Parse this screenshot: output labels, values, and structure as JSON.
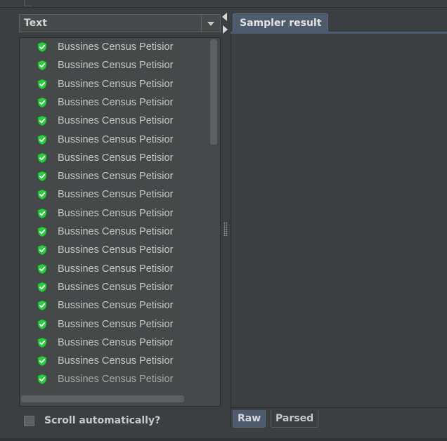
{
  "results_tree": {
    "renderer_select": {
      "value": "Text"
    },
    "items": [
      {
        "label": "Bussines Census Petisior",
        "status": "success"
      },
      {
        "label": "Bussines Census Petisior",
        "status": "success"
      },
      {
        "label": "Bussines Census Petisior",
        "status": "success"
      },
      {
        "label": "Bussines Census Petisior",
        "status": "success"
      },
      {
        "label": "Bussines Census Petisior",
        "status": "success"
      },
      {
        "label": "Bussines Census Petisior",
        "status": "success"
      },
      {
        "label": "Bussines Census Petisior",
        "status": "success"
      },
      {
        "label": "Bussines Census Petisior",
        "status": "success"
      },
      {
        "label": "Bussines Census Petisior",
        "status": "success"
      },
      {
        "label": "Bussines Census Petisior",
        "status": "success"
      },
      {
        "label": "Bussines Census Petisior",
        "status": "success"
      },
      {
        "label": "Bussines Census Petisior",
        "status": "success"
      },
      {
        "label": "Bussines Census Petisior",
        "status": "success"
      },
      {
        "label": "Bussines Census Petisior",
        "status": "success"
      },
      {
        "label": "Bussines Census Petisior",
        "status": "success"
      },
      {
        "label": "Bussines Census Petisior",
        "status": "success"
      },
      {
        "label": "Bussines Census Petisior",
        "status": "success"
      },
      {
        "label": "Bussines Census Petisior",
        "status": "success"
      },
      {
        "label": "Bussines Census Petisior",
        "status": "success"
      }
    ],
    "status_icon": "shield-check-icon",
    "success_color": "#2ecc40",
    "scroll_auto": {
      "label": "Scroll automatically?",
      "checked": false
    }
  },
  "result_panel": {
    "tabs": [
      {
        "label": "Sampler result",
        "active": true
      }
    ],
    "view_tabs": [
      {
        "label": "Raw",
        "active": true
      },
      {
        "label": "Parsed",
        "active": false
      }
    ]
  },
  "colors": {
    "background": "#3c3f41",
    "panel": "#45494a",
    "active_tab": "#4e5b6e",
    "text": "#c8c8c8"
  }
}
